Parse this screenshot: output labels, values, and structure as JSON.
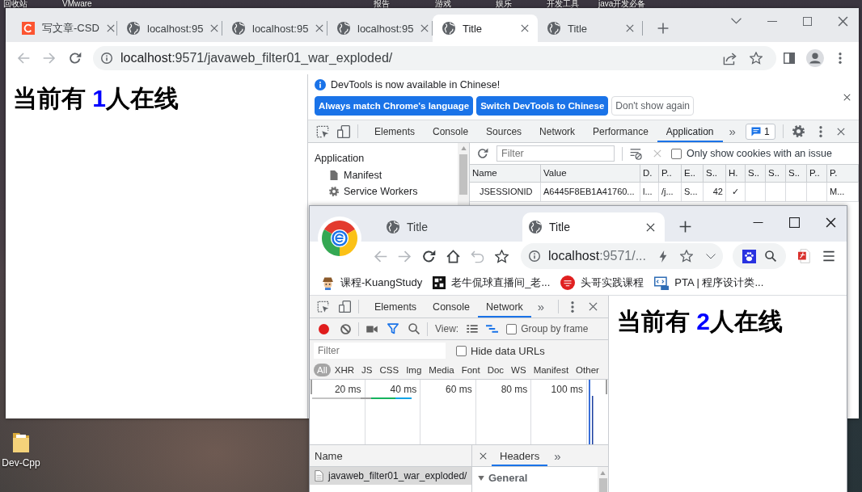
{
  "desktop": {
    "top_labels": [
      "回收站",
      "VMware",
      "报告",
      "游戏",
      "娱乐",
      "开发工具",
      "java开发必备"
    ],
    "icons": [
      {
        "label": "Dev-Cpp"
      }
    ]
  },
  "main_window": {
    "tabs": [
      {
        "kind": "csdn",
        "title": "写文章-CSD",
        "selected": false
      },
      {
        "kind": "page",
        "title": "localhost:95",
        "selected": false
      },
      {
        "kind": "page",
        "title": "localhost:95",
        "selected": false
      },
      {
        "kind": "page",
        "title": "localhost:95",
        "selected": false
      },
      {
        "kind": "page",
        "title": "Title",
        "selected": true
      },
      {
        "kind": "page",
        "title": "Title",
        "selected": false
      }
    ],
    "toolbar": [
      {
        "kind": "back",
        "disabled": true
      },
      {
        "kind": "forward",
        "disabled": true
      },
      {
        "kind": "reload",
        "disabled": false
      }
    ],
    "address": {
      "host": "localhost",
      "path": ":9571/javaweb_filter01_war_exploded/"
    },
    "page": {
      "prefix": "当前有 ",
      "count": "1",
      "suffix": "人在线"
    },
    "devtools": {
      "infobar": {
        "message": "DevTools is now available in Chinese!",
        "buttons": [
          {
            "label": "Always match Chrome's language",
            "primary": true
          },
          {
            "label": "Switch DevTools to Chinese",
            "primary": true
          },
          {
            "label": "Don't show again",
            "primary": false
          }
        ]
      },
      "tabs": [
        {
          "label": "Elements",
          "selected": false
        },
        {
          "label": "Console",
          "selected": false
        },
        {
          "label": "Sources",
          "selected": false
        },
        {
          "label": "Network",
          "selected": false
        },
        {
          "label": "Performance",
          "selected": false
        },
        {
          "label": "Application",
          "selected": true
        }
      ],
      "more": "»",
      "issues_count": "1",
      "sidebar": {
        "title": "Application",
        "items": [
          {
            "kind": "file",
            "label": "Manifest"
          },
          {
            "kind": "gear",
            "label": "Service Workers"
          }
        ]
      },
      "cookies": {
        "filter_placeholder": "Filter",
        "only_issues": {
          "label": "Only show cookies with an issue",
          "checked": false
        },
        "columns": [
          "Name",
          "Value",
          "D.",
          "P..",
          "E..",
          "S..",
          "H.",
          "S..",
          "S..",
          "S..",
          "P..",
          "P."
        ],
        "rows": [
          {
            "cells": [
              "JSESSIONID",
              "A6445F8EB1A41760...",
              "l...",
              "/j...",
              "S...",
              "42",
              "✓",
              null,
              null,
              null,
              null,
              "M..."
            ]
          }
        ]
      }
    }
  },
  "second_window": {
    "tabs": [
      {
        "title": "Title",
        "selected": false
      },
      {
        "title": "Title",
        "selected": true
      }
    ],
    "toolbar": [
      {
        "kind": "back",
        "disabled": true
      },
      {
        "kind": "forward",
        "disabled": true
      },
      {
        "kind": "reload",
        "disabled": false
      },
      {
        "kind": "home",
        "disabled": false
      },
      {
        "kind": "undo",
        "disabled": true
      },
      {
        "kind": "star",
        "disabled": false
      }
    ],
    "address": {
      "host": "localhost",
      "path": ":9571/..."
    },
    "bookmarks": [
      {
        "kind": "kuang",
        "label": "课程-KuangStudy"
      },
      {
        "kind": "live",
        "label": "老牛侃球直播间_老..."
      },
      {
        "kind": "touge",
        "label": "头哥实践课程"
      },
      {
        "kind": "pta",
        "label": "PTA | 程序设计类..."
      }
    ],
    "devtools": {
      "tabs": [
        {
          "label": "Elements",
          "selected": false
        },
        {
          "label": "Console",
          "selected": false
        },
        {
          "label": "Network",
          "selected": true
        }
      ],
      "more": "»",
      "recording": true,
      "filter_shown": true,
      "overview_shown": true,
      "view_label": "View:",
      "group_by_frame": {
        "label": "Group by frame",
        "checked": false
      },
      "filter_placeholder": "Filter",
      "hide_data_urls": {
        "label": "Hide data URLs",
        "checked": false
      },
      "types": [
        {
          "label": "All",
          "selected": true
        },
        {
          "label": "XHR",
          "selected": false
        },
        {
          "label": "JS",
          "selected": false
        },
        {
          "label": "CSS",
          "selected": false
        },
        {
          "label": "Img",
          "selected": false
        },
        {
          "label": "Media",
          "selected": false
        },
        {
          "label": "Font",
          "selected": false
        },
        {
          "label": "Doc",
          "selected": false
        },
        {
          "label": "WS",
          "selected": false
        },
        {
          "label": "Manifest",
          "selected": false
        },
        {
          "label": "Other",
          "selected": false
        }
      ],
      "timeline_ticks": [
        "20 ms",
        "40 ms",
        "60 ms",
        "80 ms",
        "100 ms"
      ],
      "requests": {
        "column": "Name",
        "rows": [
          {
            "name": "javaweb_filter01_war_exploded/",
            "selected": true
          }
        ]
      },
      "details": {
        "tabs": [
          {
            "label": "Headers",
            "selected": true
          }
        ],
        "more": "»",
        "sections": [
          {
            "title": "General",
            "expanded": true
          }
        ]
      }
    },
    "page": {
      "prefix": "当前有 ",
      "count": "2",
      "suffix": "人在线"
    }
  }
}
